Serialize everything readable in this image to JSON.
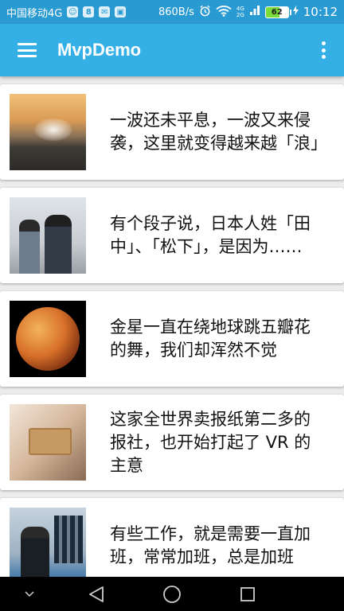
{
  "status_bar": {
    "carrier": "中国移动4G",
    "speed": "860B/s",
    "net_top": "4G",
    "net_bottom": "2G",
    "battery": "62",
    "battery_level": 0.62,
    "time": "10:12"
  },
  "app_bar": {
    "title": "MvpDemo"
  },
  "news": [
    {
      "title": "一波还未平息，一波又来侵袭，这里就变得越来越「浪」"
    },
    {
      "title": "有个段子说，日本人姓「田中」、「松下」，是因为……"
    },
    {
      "title": "金星一直在绕地球跳五瓣花的舞，我们却浑然不觉"
    },
    {
      "title": "这家全世界卖报纸第二多的报社，也开始打起了 VR 的主意"
    },
    {
      "title": "有些工作，就是需要一直加班，常常加班，总是加班"
    }
  ],
  "colors": {
    "status_bar": "#2a9ad3",
    "app_bar": "#35b0e7",
    "battery_fill": "#7cdc3a",
    "nav_bar": "#000000"
  },
  "icons": [
    "hamburger-menu-icon",
    "overflow-menu-icon",
    "back-icon",
    "home-icon",
    "recents-icon",
    "collapse-chevron-icon"
  ]
}
